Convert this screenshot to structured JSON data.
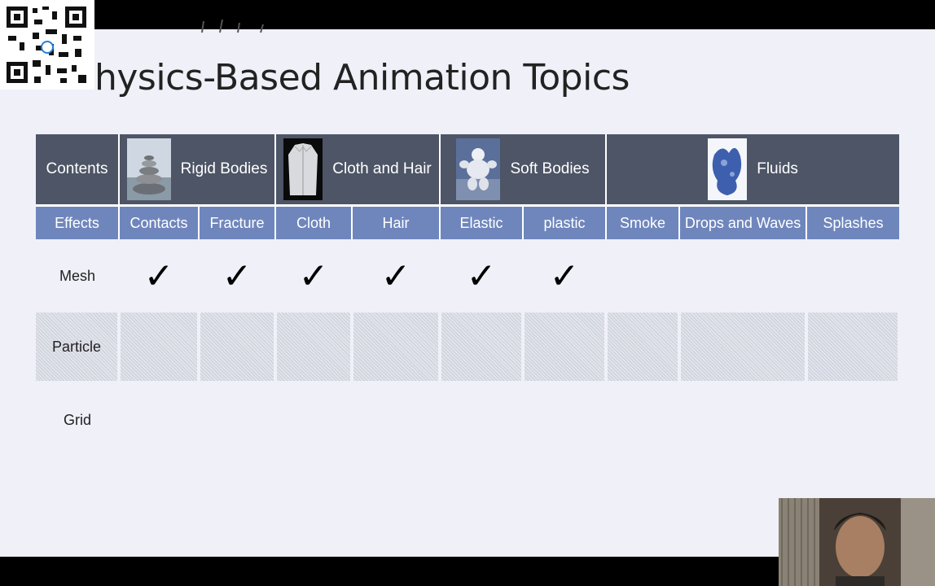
{
  "slide": {
    "title": "hysics-Based Animation Topics"
  },
  "header_row": {
    "contents_label": "Contents",
    "categories": [
      {
        "label": "Rigid Bodies",
        "icon": "stacked-stones-image"
      },
      {
        "label": "Cloth and Hair",
        "icon": "jacket-image"
      },
      {
        "label": "Soft Bodies",
        "icon": "michelin-man-image"
      },
      {
        "label": "Fluids",
        "icon": "fluid-splash-image"
      }
    ]
  },
  "effects_row": {
    "label": "Effects",
    "items": [
      "Contacts",
      "Fracture",
      "Cloth",
      "Hair",
      "Elastic",
      "plastic",
      "Smoke",
      "Drops and Waves",
      "Splashes"
    ]
  },
  "rows": {
    "mesh": {
      "label": "Mesh",
      "check": "✓"
    },
    "particle": {
      "label": "Particle"
    },
    "grid": {
      "label": "Grid"
    }
  },
  "mesh_checked": [
    true,
    true,
    true,
    true,
    true,
    true,
    false,
    false,
    false
  ],
  "colors": {
    "header_bg": "#4d5566",
    "effects_bg": "#6f86bd",
    "slide_bg": "#eff0f8"
  }
}
